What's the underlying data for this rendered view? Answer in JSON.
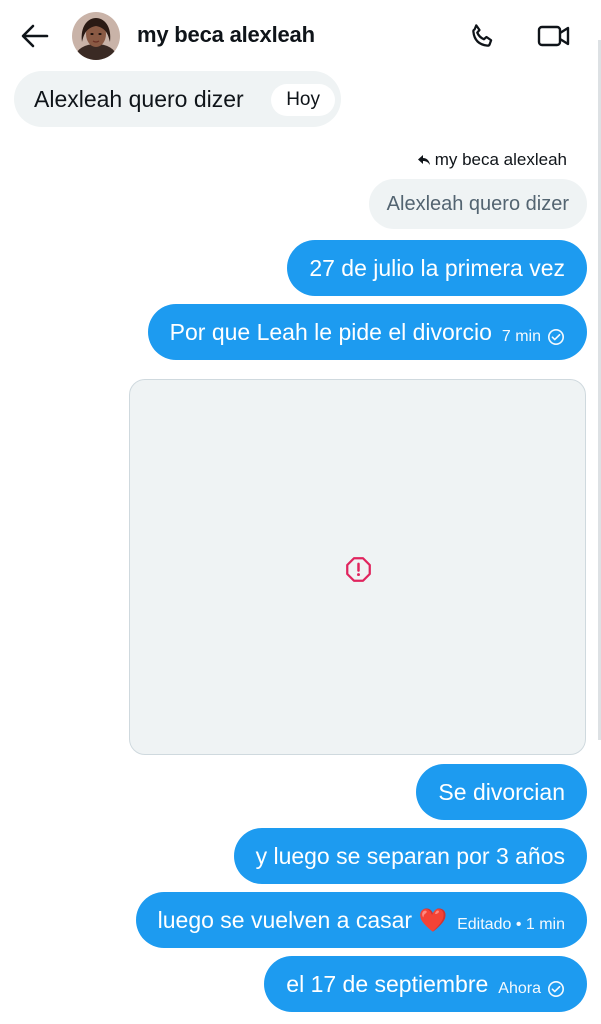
{
  "header": {
    "title": "my beca alexleah",
    "avatar": "avatar",
    "back_icon": "back-arrow-icon",
    "call_icon": "phone-icon",
    "video_icon": "video-camera-icon"
  },
  "received": {
    "text": "Alexleah quero dizer",
    "time_label": "Hoy"
  },
  "reply": {
    "label": "my beca alexleah",
    "quoted_text": "Alexleah quero dizer"
  },
  "messages": [
    {
      "text": "27 de julio la primera vez"
    },
    {
      "text": "Por que Leah le pide el divorcio",
      "meta": "7 min"
    },
    {
      "text": "Se divorcian"
    },
    {
      "text": "y luego se separan por 3 años"
    },
    {
      "text": "luego se vuelven a casar ❤️",
      "meta": "Editado • 1 min"
    },
    {
      "text": "el 17 de septiembre",
      "meta": "Ahora"
    }
  ],
  "media": {
    "error_icon": "error-octagon-icon"
  },
  "colors": {
    "accent": "#1d9bf0",
    "bubble_received": "#eff3f4",
    "error": "#e0245e"
  }
}
